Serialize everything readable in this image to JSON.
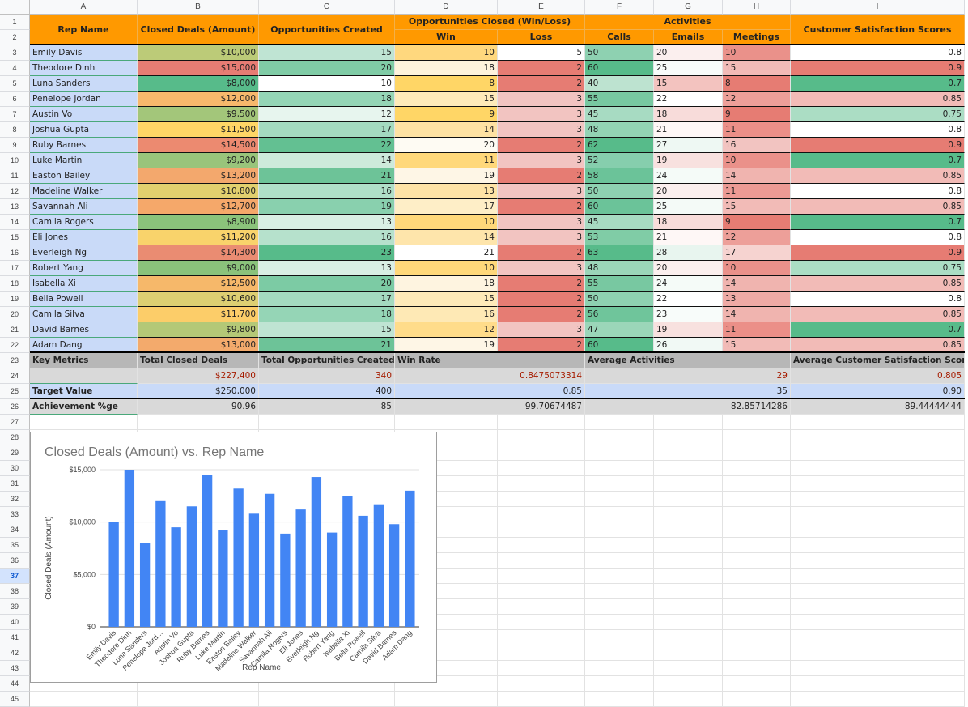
{
  "columns": [
    "A",
    "B",
    "C",
    "D",
    "E",
    "F",
    "G",
    "H",
    "I"
  ],
  "row_numbers": [
    1,
    2,
    3,
    4,
    5,
    6,
    7,
    8,
    9,
    10,
    11,
    12,
    13,
    14,
    15,
    16,
    17,
    18,
    19,
    20,
    21,
    22,
    23,
    24,
    25,
    26,
    27,
    28,
    29,
    30,
    31,
    32,
    33,
    34,
    35,
    36,
    37,
    38,
    39,
    40,
    41,
    42,
    43,
    44,
    45
  ],
  "selected_row": 37,
  "header": {
    "rep_name": "Rep Name",
    "closed_deals": "Closed Deals (Amount)",
    "opps_created": "Opportunities Created",
    "opps_closed": "Opportunities Closed (Win/Loss)",
    "win": "Win",
    "loss": "Loss",
    "activities": "Activities",
    "calls": "Calls",
    "emails": "Emails",
    "meetings": "Meetings",
    "csat": "Customer Satisfaction Scores"
  },
  "rows": [
    {
      "name": "Emily Davis",
      "deals": "$10,000",
      "opps": "15",
      "win": "10",
      "loss": "5",
      "calls": "50",
      "emails": "20",
      "meetings": "10",
      "csat": "0.8"
    },
    {
      "name": "Theodore Dinh",
      "deals": "$15,000",
      "opps": "20",
      "win": "18",
      "loss": "2",
      "calls": "60",
      "emails": "25",
      "meetings": "15",
      "csat": "0.9"
    },
    {
      "name": "Luna Sanders",
      "deals": "$8,000",
      "opps": "10",
      "win": "8",
      "loss": "2",
      "calls": "40",
      "emails": "15",
      "meetings": "8",
      "csat": "0.7"
    },
    {
      "name": "Penelope Jordan",
      "deals": "$12,000",
      "opps": "18",
      "win": "15",
      "loss": "3",
      "calls": "55",
      "emails": "22",
      "meetings": "12",
      "csat": "0.85"
    },
    {
      "name": "Austin Vo",
      "deals": "$9,500",
      "opps": "12",
      "win": "9",
      "loss": "3",
      "calls": "45",
      "emails": "18",
      "meetings": "9",
      "csat": "0.75"
    },
    {
      "name": "Joshua Gupta",
      "deals": "$11,500",
      "opps": "17",
      "win": "14",
      "loss": "3",
      "calls": "48",
      "emails": "21",
      "meetings": "11",
      "csat": "0.8"
    },
    {
      "name": "Ruby Barnes",
      "deals": "$14,500",
      "opps": "22",
      "win": "20",
      "loss": "2",
      "calls": "62",
      "emails": "27",
      "meetings": "16",
      "csat": "0.9"
    },
    {
      "name": "Luke Martin",
      "deals": "$9,200",
      "opps": "14",
      "win": "11",
      "loss": "3",
      "calls": "52",
      "emails": "19",
      "meetings": "10",
      "csat": "0.7"
    },
    {
      "name": "Easton Bailey",
      "deals": "$13,200",
      "opps": "21",
      "win": "19",
      "loss": "2",
      "calls": "58",
      "emails": "24",
      "meetings": "14",
      "csat": "0.85"
    },
    {
      "name": "Madeline Walker",
      "deals": "$10,800",
      "opps": "16",
      "win": "13",
      "loss": "3",
      "calls": "50",
      "emails": "20",
      "meetings": "11",
      "csat": "0.8"
    },
    {
      "name": "Savannah Ali",
      "deals": "$12,700",
      "opps": "19",
      "win": "17",
      "loss": "2",
      "calls": "60",
      "emails": "25",
      "meetings": "15",
      "csat": "0.85"
    },
    {
      "name": "Camila Rogers",
      "deals": "$8,900",
      "opps": "13",
      "win": "10",
      "loss": "3",
      "calls": "45",
      "emails": "18",
      "meetings": "9",
      "csat": "0.7"
    },
    {
      "name": "Eli Jones",
      "deals": "$11,200",
      "opps": "16",
      "win": "14",
      "loss": "3",
      "calls": "53",
      "emails": "21",
      "meetings": "12",
      "csat": "0.8"
    },
    {
      "name": "Everleigh Ng",
      "deals": "$14,300",
      "opps": "23",
      "win": "21",
      "loss": "2",
      "calls": "63",
      "emails": "28",
      "meetings": "17",
      "csat": "0.9"
    },
    {
      "name": "Robert Yang",
      "deals": "$9,000",
      "opps": "13",
      "win": "10",
      "loss": "3",
      "calls": "48",
      "emails": "20",
      "meetings": "10",
      "csat": "0.75"
    },
    {
      "name": "Isabella Xi",
      "deals": "$12,500",
      "opps": "20",
      "win": "18",
      "loss": "2",
      "calls": "55",
      "emails": "24",
      "meetings": "14",
      "csat": "0.85"
    },
    {
      "name": "Bella Powell",
      "deals": "$10,600",
      "opps": "17",
      "win": "15",
      "loss": "2",
      "calls": "50",
      "emails": "22",
      "meetings": "13",
      "csat": "0.8"
    },
    {
      "name": "Camila Silva",
      "deals": "$11,700",
      "opps": "18",
      "win": "16",
      "loss": "2",
      "calls": "56",
      "emails": "23",
      "meetings": "14",
      "csat": "0.85"
    },
    {
      "name": "David Barnes",
      "deals": "$9,800",
      "opps": "15",
      "win": "12",
      "loss": "3",
      "calls": "47",
      "emails": "19",
      "meetings": "11",
      "csat": "0.7"
    },
    {
      "name": "Adam Dang",
      "deals": "$13,000",
      "opps": "21",
      "win": "19",
      "loss": "2",
      "calls": "60",
      "emails": "26",
      "meetings": "15",
      "csat": "0.85"
    }
  ],
  "row_colors": [
    {
      "deals": "#bccb78",
      "opps": "#bfe4d3",
      "win": "#ffd87e",
      "loss": "#ffffff",
      "calls": "#8ed1b1",
      "emails": "#fbefee",
      "meetings": "#ea918a",
      "csat": "#ffffff"
    },
    {
      "deals": "#e67c73",
      "opps": "#80cca6",
      "win": "#fef3dc",
      "loss": "#e67c73",
      "calls": "#57bb8a",
      "emails": "#f8fcfa",
      "meetings": "#f2bbb7",
      "csat": "#e67c73"
    },
    {
      "deals": "#57bb8a",
      "opps": "#ffffff",
      "win": "#ffd666",
      "loss": "#e67c73",
      "calls": "#bde3d0",
      "emails": "#f3c3bf",
      "meetings": "#e67c73",
      "csat": "#57bb8a"
    },
    {
      "deals": "#f7b86c",
      "opps": "#95d5b6",
      "win": "#feeab9",
      "loss": "#f2c4c1",
      "calls": "#78c8a1",
      "emails": "#ffffff",
      "meetings": "#ed9f99",
      "csat": "#f2bbb7"
    },
    {
      "deals": "#a3c67a",
      "opps": "#e7f5ee",
      "win": "#ffd666",
      "loss": "#f2c4c1",
      "calls": "#a7dbc2",
      "emails": "#f8dcda",
      "meetings": "#e67c73",
      "csat": "#abddc4"
    },
    {
      "deals": "#ffd666",
      "opps": "#a4dac0",
      "win": "#fee2a3",
      "loss": "#f2c4c1",
      "calls": "#93d3b4",
      "emails": "#fef7f6",
      "meetings": "#eb8f88",
      "csat": "#ffffff"
    },
    {
      "deals": "#ec8a70",
      "opps": "#63c092",
      "win": "#fefbf3",
      "loss": "#e67c73",
      "calls": "#57bb8a",
      "emails": "#eef8f3",
      "meetings": "#f2c4c1",
      "csat": "#e67c73"
    },
    {
      "deals": "#99c47b",
      "opps": "#cdeadb",
      "win": "#ffd87a",
      "loss": "#f2c4c1",
      "calls": "#86cead",
      "emails": "#f8e1df",
      "meetings": "#ea918a",
      "csat": "#57bb8a"
    },
    {
      "deals": "#f3a86d",
      "opps": "#6dc398",
      "win": "#fef6e6",
      "loss": "#e67c73",
      "calls": "#6bc399",
      "emails": "#f5fbf8",
      "meetings": "#f0b4af",
      "csat": "#f2bbb7"
    },
    {
      "deals": "#e2d06e",
      "opps": "#b0dfc8",
      "win": "#fee3a6",
      "loss": "#f2c4c1",
      "calls": "#8ed1b1",
      "emails": "#fbefee",
      "meetings": "#ec9a94",
      "csat": "#ffffff"
    },
    {
      "deals": "#f5a86a",
      "opps": "#89d0ae",
      "win": "#feeec7",
      "loss": "#e67c73",
      "calls": "#6bc399",
      "emails": "#f4faf7",
      "meetings": "#f2bbb7",
      "csat": "#f2bbb7"
    },
    {
      "deals": "#8bc37b",
      "opps": "#d9efe4",
      "win": "#ffd87a",
      "loss": "#f2c4c1",
      "calls": "#a7dbc2",
      "emails": "#f8dcda",
      "meetings": "#e67c73",
      "csat": "#57bb8a"
    },
    {
      "deals": "#f9d36b",
      "opps": "#b6e1cc",
      "win": "#fee5ab",
      "loss": "#f2c4c1",
      "calls": "#80cca6",
      "emails": "#fef7f6",
      "meetings": "#ed9f99",
      "csat": "#ffffff"
    },
    {
      "deals": "#ea8c72",
      "opps": "#57bb8a",
      "win": "#ffffff",
      "loss": "#e67c73",
      "calls": "#57bb8a",
      "emails": "#e8f5ef",
      "meetings": "#f6d3d0",
      "csat": "#e67c73"
    },
    {
      "deals": "#8ac27b",
      "opps": "#d9efe4",
      "win": "#ffd87a",
      "loss": "#f2c4c1",
      "calls": "#9bd6b9",
      "emails": "#fbefee",
      "meetings": "#ea918a",
      "csat": "#abddc4"
    },
    {
      "deals": "#f6b86a",
      "opps": "#7ccba4",
      "win": "#fef4e0",
      "loss": "#e67c73",
      "calls": "#78c8a1",
      "emails": "#f5fbf8",
      "meetings": "#f0b4af",
      "csat": "#f2bbb7"
    },
    {
      "deals": "#ddcf72",
      "opps": "#a4dac0",
      "win": "#feeab9",
      "loss": "#e67c73",
      "calls": "#8ed1b1",
      "emails": "#ffffff",
      "meetings": "#eeaaa5",
      "csat": "#ffffff"
    },
    {
      "deals": "#fccd69",
      "opps": "#95d5b6",
      "win": "#fee9b5",
      "loss": "#e67c73",
      "calls": "#6fc59b",
      "emails": "#f8fcfa",
      "meetings": "#f0b4af",
      "csat": "#f2bbb7"
    },
    {
      "deals": "#b4c877",
      "opps": "#bfe4d3",
      "win": "#ffdc8a",
      "loss": "#f2c4c1",
      "calls": "#9bd6b9",
      "emails": "#f8e1df",
      "meetings": "#eb8f88",
      "csat": "#57bb8a"
    },
    {
      "deals": "#f3aa6c",
      "opps": "#6dc398",
      "win": "#fef6e6",
      "loss": "#e67c73",
      "calls": "#57bb8a",
      "emails": "#f1f9f5",
      "meetings": "#f2bbb7",
      "csat": "#f2bbb7"
    }
  ],
  "metrics": {
    "key_metrics": "Key Metrics",
    "total_closed_deals_label": "Total Closed Deals",
    "total_opps_label": "Total Opportunities Created",
    "win_rate_label": "Win Rate",
    "avg_activities_label": "Average Activities",
    "avg_csat_label": "Average Customer Satisfaction Score",
    "actual": {
      "deals": "$227,400",
      "opps": "340",
      "win_rate": "0.8475073314",
      "activities": "29",
      "csat": "0.805"
    },
    "target_label": "Target Value",
    "target": {
      "deals": "$250,000",
      "opps": "400",
      "win_rate": "0.85",
      "activities": "35",
      "csat": "0.90"
    },
    "achievement_label": "Achievement %ge",
    "achievement": {
      "deals": "90.96",
      "opps": "85",
      "win_rate": "99.70674487",
      "activities": "82.85714286",
      "csat": "89.44444444"
    }
  },
  "chart_data": {
    "type": "bar",
    "title": "Closed Deals (Amount) vs. Rep Name",
    "xlabel": "Rep Name",
    "ylabel": "Closed Deals (Amount)",
    "ylim": [
      0,
      15000
    ],
    "yticks": [
      0,
      5000,
      10000,
      15000
    ],
    "ytick_labels": [
      "$0",
      "$5,000",
      "$10,000",
      "$15,000"
    ],
    "grid": true,
    "bar_color": "#4285f4",
    "categories": [
      "Emily Davis",
      "Theodore Dinh",
      "Luna Sanders",
      "Penelope Jord...",
      "Austin Vo",
      "Joshua Gupta",
      "Ruby Barnes",
      "Luke Martin",
      "Easton Bailey",
      "Madeline Walker",
      "Savannah Ali",
      "Camila Rogers",
      "Eli Jones",
      "Everleigh Ng",
      "Robert Yang",
      "Isabella Xi",
      "Bella Powell",
      "Camila Silva",
      "David Barnes",
      "Adam Dang"
    ],
    "values": [
      10000,
      15000,
      8000,
      12000,
      9500,
      11500,
      14500,
      9200,
      13200,
      10800,
      12700,
      8900,
      11200,
      14300,
      9000,
      12500,
      10600,
      11700,
      9800,
      13000
    ]
  }
}
